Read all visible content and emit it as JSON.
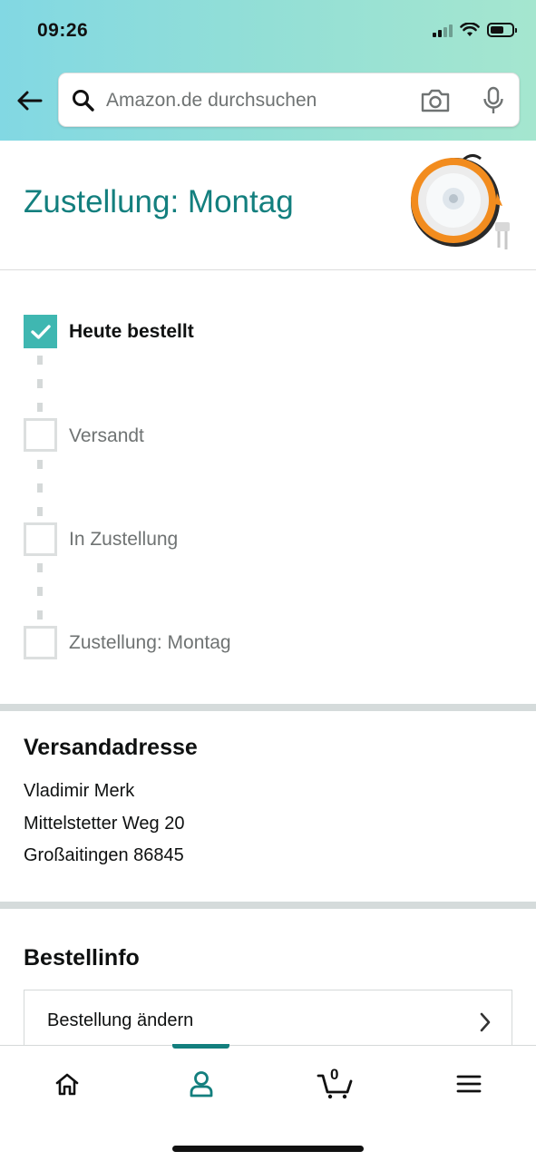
{
  "status_bar": {
    "time": "09:26"
  },
  "search": {
    "placeholder": "Amazon.de durchsuchen"
  },
  "delivery": {
    "title": "Zustellung: Montag"
  },
  "tracker": {
    "steps": [
      {
        "label": "Heute bestellt",
        "done": true
      },
      {
        "label": "Versandt",
        "done": false
      },
      {
        "label": "In Zustellung",
        "done": false
      },
      {
        "label": "Zustellung: Montag",
        "done": false
      }
    ]
  },
  "address": {
    "title": "Versandadresse",
    "name": "Vladimir Merk",
    "street": "Mittelstetter Weg 20",
    "city": "Großaitingen 86845"
  },
  "order_info": {
    "title": "Bestellinfo",
    "change_label": "Bestellung ändern"
  },
  "bottom_nav": {
    "cart_count": "0",
    "active": "account"
  },
  "colors": {
    "accent": "#137f7e",
    "check": "#3fb7b1",
    "header_gradient_start": "#82d8e3",
    "header_gradient_end": "#a5e6cf"
  },
  "icons": [
    "back-arrow-icon",
    "search-icon",
    "camera-icon",
    "microphone-icon",
    "check-icon",
    "chevron-right-icon",
    "home-icon",
    "account-icon",
    "cart-icon",
    "menu-icon"
  ]
}
